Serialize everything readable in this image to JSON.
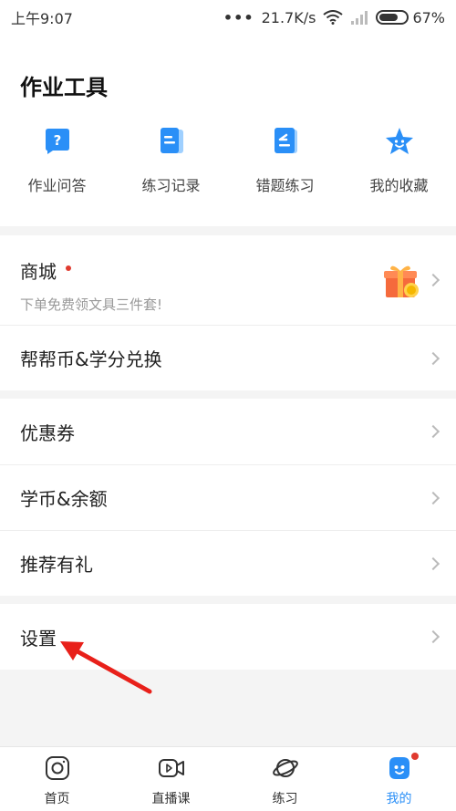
{
  "status": {
    "time": "上午9:07",
    "speed": "21.7K/s",
    "battery": "67%"
  },
  "tools": {
    "title": "作业工具",
    "items": [
      {
        "label": "作业问答",
        "icon": "question-icon"
      },
      {
        "label": "练习记录",
        "icon": "record-list-icon"
      },
      {
        "label": "错题练习",
        "icon": "wrong-question-icon"
      },
      {
        "label": "我的收藏",
        "icon": "favorite-star-icon"
      }
    ]
  },
  "menu": {
    "shop": {
      "title": "商城",
      "subtitle": "下单免费领文具三件套!"
    },
    "bangbi": "帮帮币&学分兑换",
    "coupon": "优惠券",
    "balance": "学币&余额",
    "referral": "推荐有礼",
    "settings": "设置"
  },
  "tabs": [
    {
      "label": "首页",
      "icon": "home-camera-icon"
    },
    {
      "label": "直播课",
      "icon": "live-video-icon"
    },
    {
      "label": "练习",
      "icon": "planet-icon"
    },
    {
      "label": "我的",
      "icon": "profile-mascot-icon"
    }
  ],
  "colors": {
    "accent": "#2a8ff7",
    "red": "#e03a2f"
  }
}
